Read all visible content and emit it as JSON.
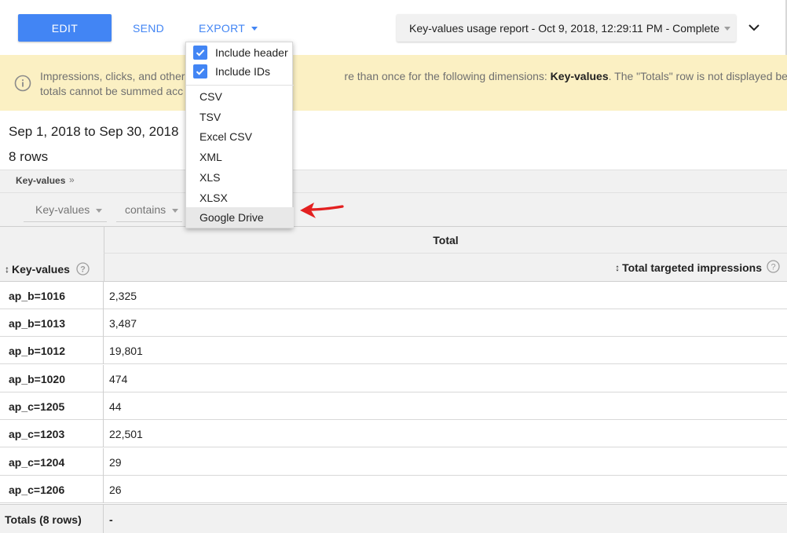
{
  "toolbar": {
    "edit_label": "EDIT",
    "send_label": "SEND",
    "export_label": "EXPORT",
    "report_title": "Key-values usage report - Oct 9, 2018, 12:29:11 PM - Complete"
  },
  "banner": {
    "line1_pre": "Impressions, clicks, and other",
    "line1_mid": "re than once for the following dimensions: ",
    "line1_bold": "Key-values",
    "line1_post": ". The \"Totals\" row is not displayed because repor",
    "line2": "totals cannot be summed acc"
  },
  "summary": {
    "date_range": "Sep 1, 2018 to Sep 30, 2018",
    "row_count": "8 rows"
  },
  "breadcrumb": {
    "label": "Key-values",
    "separator": "»"
  },
  "filter": {
    "dimension": "Key-values",
    "operator": "contains"
  },
  "table": {
    "group_header": "Total",
    "dimension_header": "Key-values",
    "metric_header": "Total targeted impressions",
    "rows": [
      {
        "key": "ap_b=1016",
        "value": "2,325"
      },
      {
        "key": "ap_b=1013",
        "value": "3,487"
      },
      {
        "key": "ap_b=1012",
        "value": "19,801"
      },
      {
        "key": "ap_b=1020",
        "value": "474"
      },
      {
        "key": "ap_c=1205",
        "value": "44"
      },
      {
        "key": "ap_c=1203",
        "value": "22,501"
      },
      {
        "key": "ap_c=1204",
        "value": "29"
      },
      {
        "key": "ap_c=1206",
        "value": "26"
      }
    ],
    "totals_label": "Totals (8 rows)",
    "totals_value": "-"
  },
  "export_menu": {
    "include_header": "Include header",
    "include_ids": "Include IDs",
    "formats": [
      "CSV",
      "TSV",
      "Excel CSV",
      "XML",
      "XLS",
      "XLSX",
      "Google Drive"
    ],
    "highlighted": "Google Drive"
  },
  "colors": {
    "accent": "#4285f4",
    "banner_bg": "#fbf0c3",
    "arrow": "#e32020"
  }
}
